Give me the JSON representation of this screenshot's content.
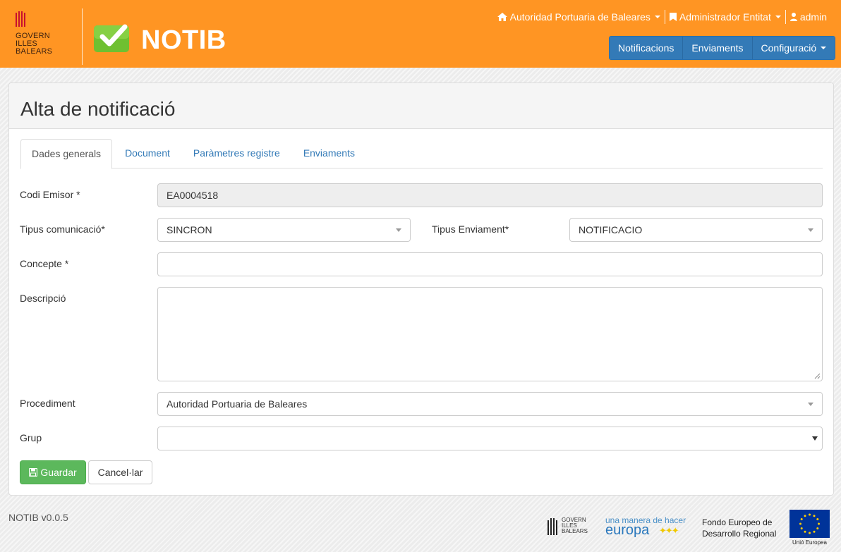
{
  "header": {
    "brand": {
      "logo_text": [
        "GOVERN",
        "ILLES",
        "BALEARS"
      ],
      "app_name": "NOTIB"
    },
    "top_links": [
      {
        "label": "Autoridad Portuaria de Baleares",
        "icon": "home-icon",
        "has_dropdown": true
      },
      {
        "label": "Administrador Entitat",
        "icon": "bookmark-icon",
        "has_dropdown": true
      },
      {
        "label": "admin",
        "icon": "user-icon",
        "has_dropdown": false
      }
    ],
    "nav": [
      {
        "label": "Notificacions"
      },
      {
        "label": "Enviaments"
      },
      {
        "label": "Configuració",
        "has_dropdown": true
      }
    ]
  },
  "page": {
    "title": "Alta de notificació",
    "tabs": [
      {
        "label": "Dades generals",
        "active": true
      },
      {
        "label": "Document"
      },
      {
        "label": "Paràmetres registre"
      },
      {
        "label": "Enviaments"
      }
    ]
  },
  "form": {
    "codi_emisor": {
      "label": "Codi Emisor *",
      "value": "EA0004518"
    },
    "tipus_comunicacio": {
      "label": "Tipus comunicació*",
      "value": "SINCRON"
    },
    "tipus_enviament": {
      "label": "Tipus Enviament*",
      "value": "NOTIFICACIO"
    },
    "concepte": {
      "label": "Concepte *",
      "value": ""
    },
    "descripcio": {
      "label": "Descripció",
      "value": ""
    },
    "procediment": {
      "label": "Procediment",
      "value": "Autoridad Portuaria de Baleares"
    },
    "grup": {
      "label": "Grup",
      "value": ""
    },
    "save_label": "Guardar",
    "cancel_label": "Cancel·lar"
  },
  "footer": {
    "version": "NOTIB v0.0.5",
    "logos": {
      "govern_text": [
        "GOVERN",
        "ILLES",
        "BALEARS"
      ],
      "europa_tagline": "una manera de hacer",
      "europa_word": "europa",
      "fondo_line1": "Fondo Europeo de",
      "fondo_line2": "Desarrollo Regional",
      "eu_caption": "Unió Europea"
    }
  },
  "colors": {
    "header_bg": "#ff9523",
    "nav_button": "#337ab7",
    "save_button": "#5cb85c",
    "link": "#337ab7",
    "check_green": "#6fc031"
  }
}
